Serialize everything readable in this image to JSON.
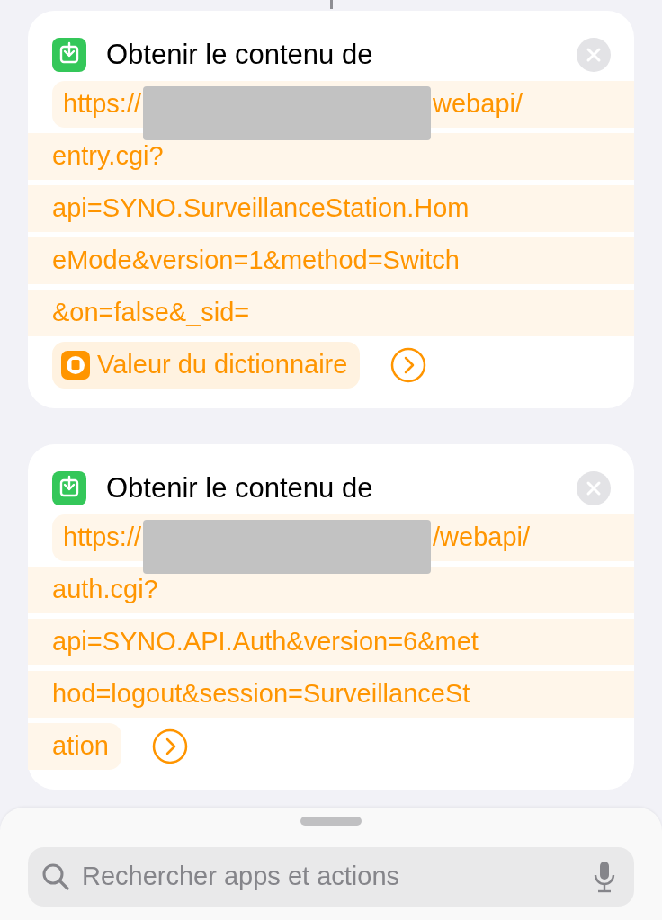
{
  "actions": [
    {
      "title": "Obtenir le contenu de",
      "lines": [
        {
          "kind": "host",
          "prefix": "https://",
          "suffix": "webapi/"
        },
        {
          "kind": "text",
          "text": "entry.cgi?"
        },
        {
          "kind": "text",
          "text": "api=SYNO.SurveillanceStation.Hom"
        },
        {
          "kind": "text",
          "text": "eMode&version=1&method=Switch"
        },
        {
          "kind": "text",
          "text": "&on=false&_sid="
        },
        {
          "kind": "variable",
          "text": "Valeur du dictionnaire"
        }
      ]
    },
    {
      "title": "Obtenir le contenu de",
      "lines": [
        {
          "kind": "host",
          "prefix": "https://",
          "suffix": "/webapi/"
        },
        {
          "kind": "text",
          "text": "auth.cgi?"
        },
        {
          "kind": "text",
          "text": "api=SYNO.API.Auth&version=6&met"
        },
        {
          "kind": "text",
          "text": "hod=logout&session=SurveillanceSt"
        },
        {
          "kind": "tail",
          "text": "ation"
        }
      ]
    }
  ],
  "search": {
    "placeholder": "Rechercher apps et actions"
  }
}
